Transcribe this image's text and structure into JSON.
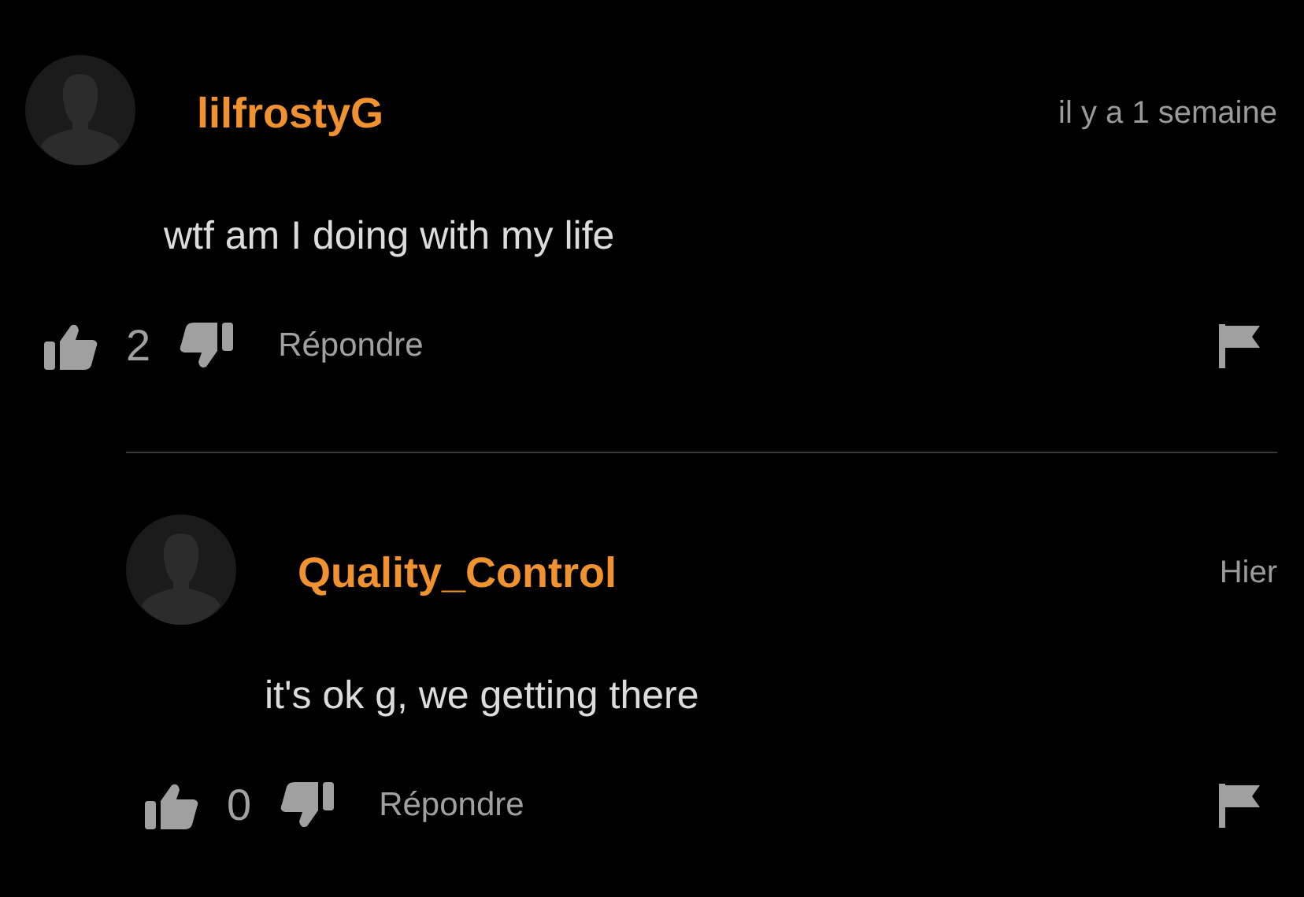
{
  "comments": [
    {
      "username": "lilfrostyG",
      "time": "il y a 1 semaine",
      "text": "wtf am I doing with my life",
      "likes": "2",
      "reply_label": "Répondre",
      "replies": [
        {
          "username": "Quality_Control",
          "time": "Hier",
          "text": "it's ok g, we getting there",
          "likes": "0",
          "reply_label": "Répondre"
        }
      ]
    }
  ]
}
